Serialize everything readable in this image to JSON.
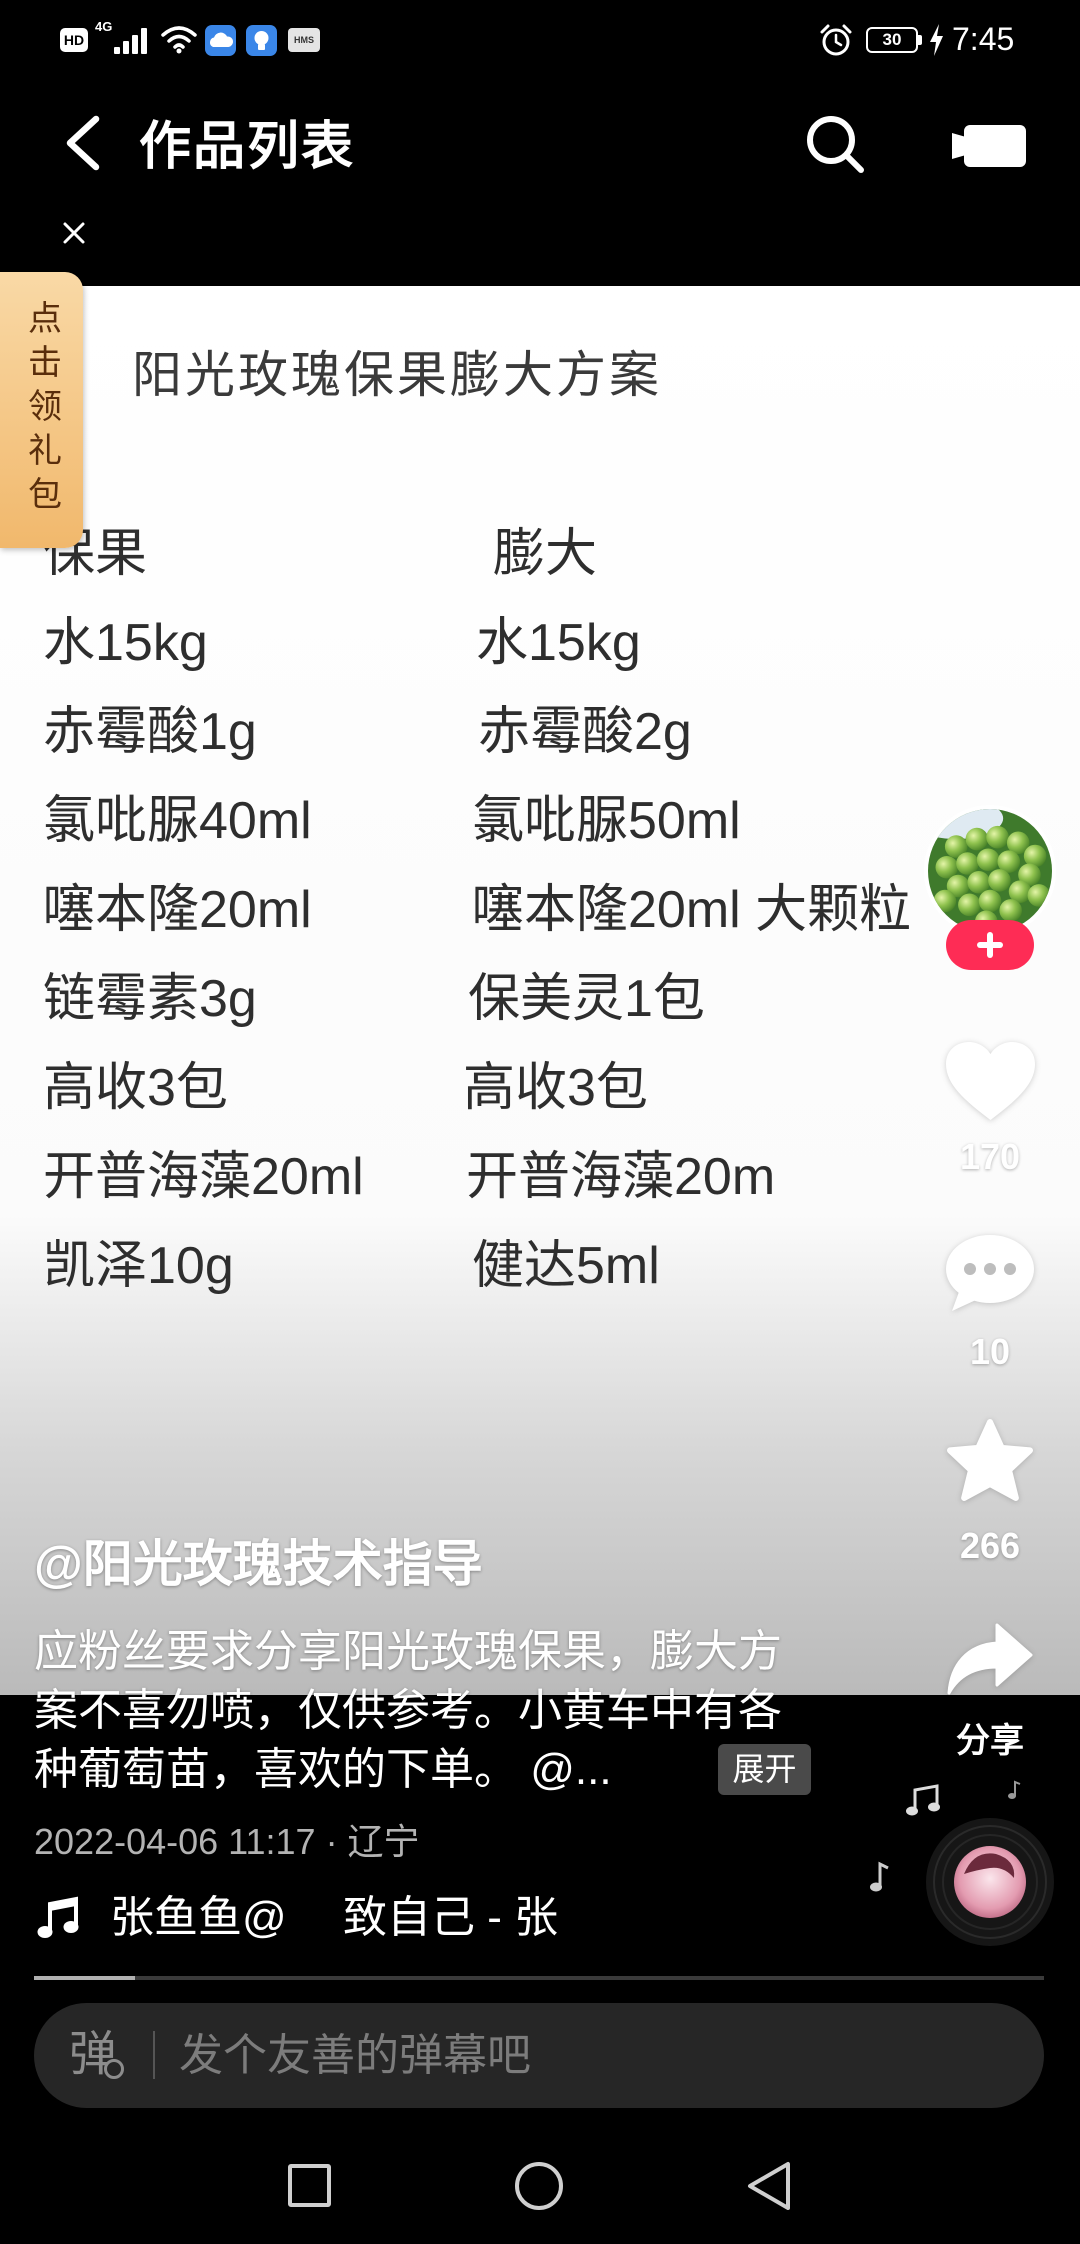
{
  "status_bar": {
    "hd_badge": "HD",
    "network_type": "4G",
    "hms_badge": "HMS",
    "battery_level": "30",
    "time": "7:45",
    "icons": [
      "signal-icon",
      "wifi-icon",
      "cloud-icon",
      "bulb-icon",
      "alarm-icon",
      "battery-icon",
      "charging-icon"
    ]
  },
  "header": {
    "title": "作品列表",
    "icons": [
      "back-icon",
      "search-icon",
      "video-icon",
      "close-icon"
    ]
  },
  "gift_tab": {
    "label": "点击领礼包"
  },
  "post_image": {
    "title": "阳光玫瑰保果膨大方案",
    "column_headers": [
      "保果",
      "膨大"
    ],
    "rows": [
      [
        "水15kg",
        "水15kg"
      ],
      [
        "赤霉酸1g",
        "赤霉酸2g"
      ],
      [
        "氯吡脲40ml",
        "氯吡脲50ml"
      ],
      [
        "噻本隆20ml",
        "噻本隆20ml 大颗粒"
      ],
      [
        "链霉素3g",
        "保美灵1包"
      ],
      [
        "高收3包",
        "高收3包"
      ],
      [
        "开普海藻20ml",
        "开普海藻20m"
      ],
      [
        "凯泽10g",
        "健达5ml"
      ]
    ]
  },
  "sidebar": {
    "likes": "170",
    "comments": "10",
    "favorites": "266",
    "share_label": "分享",
    "icons": [
      "avatar",
      "plus-icon",
      "heart-icon",
      "comment-icon",
      "star-icon",
      "share-icon",
      "music-disc-icon"
    ]
  },
  "post": {
    "author": "@阳光玫瑰技术指导",
    "description_lines": [
      "应粉丝要求分享阳光玫瑰保果，膨大方",
      "案不喜勿喷，仅供参考。小黄车中有各",
      "种葡萄苗，喜欢的下单。 @..."
    ],
    "expand_label": "展开",
    "meta": "2022-04-06 11:17 · 辽宁"
  },
  "music": {
    "author": "张鱼鱼@",
    "track": "致自己 - 张"
  },
  "playback": {
    "progress": 0.1
  },
  "comment_bar": {
    "icon_text": "弹",
    "placeholder": "发个友善的弹幕吧"
  },
  "nav_bar": {
    "icons": [
      "recents-icon",
      "home-icon",
      "nav-back-icon"
    ]
  },
  "colors": {
    "accent": "#fe2c55",
    "gift_tab": "#f4c27e",
    "background": "#000000"
  }
}
